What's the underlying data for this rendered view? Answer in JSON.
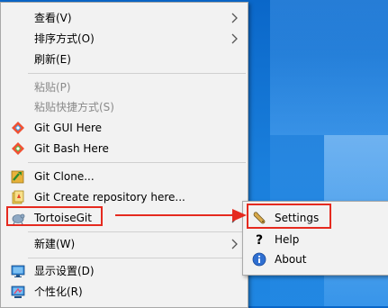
{
  "desktop": {
    "background": "#1a7fdc"
  },
  "context_menu": {
    "items": [
      {
        "label": "查看(V)",
        "has_submenu": true
      },
      {
        "label": "排序方式(O)",
        "has_submenu": true
      },
      {
        "label": "刷新(E)"
      },
      {
        "label": "粘贴(P)",
        "disabled": true
      },
      {
        "label": "粘贴快捷方式(S)",
        "disabled": true
      },
      {
        "label": "Git GUI Here",
        "icon": "git-gui-icon"
      },
      {
        "label": "Git Bash Here",
        "icon": "git-bash-icon"
      },
      {
        "label": "Git Clone...",
        "icon": "git-clone-icon"
      },
      {
        "label": "Git Create repository here...",
        "icon": "git-create-repo-icon"
      },
      {
        "label": "TortoiseGit",
        "icon": "tortoisegit-icon",
        "has_submenu": true
      },
      {
        "label": "新建(W)",
        "has_submenu": true
      },
      {
        "label": "显示设置(D)",
        "icon": "display-settings-icon"
      },
      {
        "label": "个性化(R)",
        "icon": "personalize-icon"
      }
    ]
  },
  "tortoisegit_submenu": {
    "items": [
      {
        "label": "Settings",
        "icon": "settings-wrench-icon"
      },
      {
        "label": "Help",
        "icon": "help-icon"
      },
      {
        "label": "About",
        "icon": "about-icon"
      }
    ]
  },
  "annotation": {
    "color": "#e52a1f"
  }
}
